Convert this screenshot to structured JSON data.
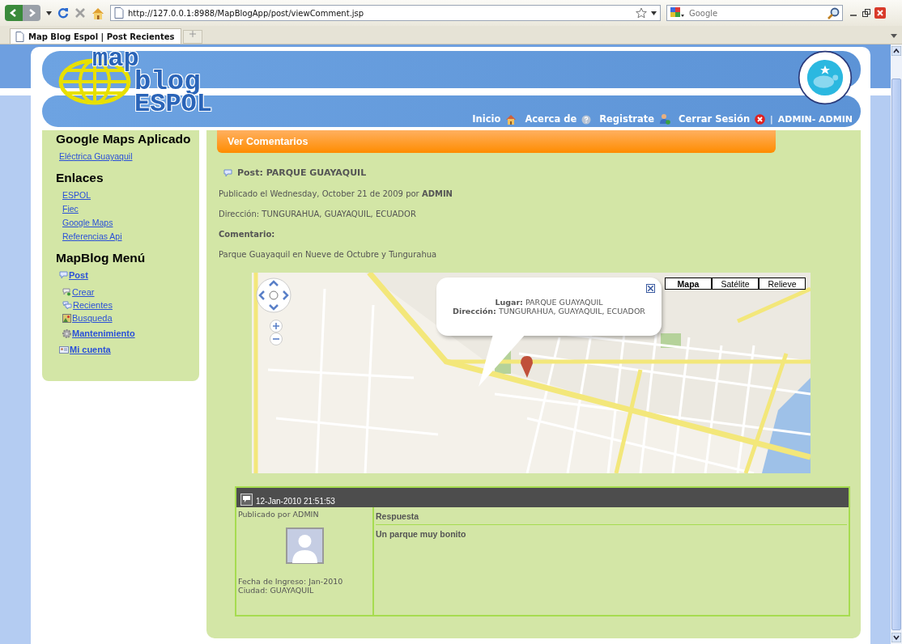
{
  "browser": {
    "url": "http://127.0.0.1:8988/MapBlogApp/post/viewComment.jsp",
    "search_placeholder": "Google",
    "tab_title": "Map Blog Espol | Post Recientes"
  },
  "header": {
    "logo_lines": [
      "map",
      "blog",
      "ESPOL"
    ],
    "nav": [
      {
        "label": "Inicio",
        "kind": "home"
      },
      {
        "label": "Acerca de",
        "kind": "help"
      },
      {
        "label": "Registrate",
        "kind": "user"
      },
      {
        "label": "Cerrar Sesión",
        "kind": "close"
      }
    ],
    "separator": "|",
    "user": "ADMIN- ADMIN"
  },
  "sidebar": {
    "sections": [
      {
        "title": "Google Maps Aplicado",
        "items": [
          {
            "label": "Eléctrica Guayaquil",
            "kind": "plain"
          }
        ]
      },
      {
        "title": "Enlaces",
        "items": [
          {
            "label": "ESPOL",
            "kind": "plain"
          },
          {
            "label": "Fiec",
            "kind": "plain"
          },
          {
            "label": "Google Maps",
            "kind": "plain"
          },
          {
            "label": "Referencias Api",
            "kind": "plain"
          }
        ]
      },
      {
        "title": "MapBlog Menú",
        "items": [
          {
            "label": "Post",
            "kind": "comment",
            "children": [
              {
                "label": "Crear",
                "kind": "create"
              },
              {
                "label": "Recientes",
                "kind": "comments"
              },
              {
                "label": "Busqueda",
                "kind": "search"
              },
              {
                "label": "Mantenimiento",
                "kind": "gear"
              }
            ]
          },
          {
            "label": "Mi cuenta",
            "kind": "card"
          }
        ]
      }
    ]
  },
  "main": {
    "section_title": "Ver Comentarios",
    "post_label": "Post:",
    "post_title": "PARQUE GUAYAQUIL",
    "published": "Publicado el Wednesday, October 21 de 2009 por **ADMIN**",
    "address": "Dirección: TUNGURAHUA, GUAYAQUIL, ECUADOR",
    "comment_label": "Comentario:",
    "comment_text": "Parque Guayaquil en Nueve de Octubre y Tungurahua",
    "map": {
      "kind": "picture",
      "map_types": [
        {
          "label": "Mapa",
          "selected": true
        },
        {
          "label": "Satélite",
          "selected": false
        },
        {
          "label": "Relieve",
          "selected": false
        }
      ],
      "info_lines": [
        "**Lugar:** PARQUE GUAYAQUIL",
        "**Dirección:** TUNGURAHUA, GUAYAQUIL, ECUADOR"
      ]
    },
    "comments": [
      {
        "timestamp": "12-Jan-2010 21:51:53",
        "author": "Publicado por ADMIN",
        "joined": "Fecha de Ingreso: Jan-2010",
        "city": "Ciudad: GUAYAQUIL",
        "heading": "Respuesta",
        "text": "Un parque muy bonito"
      }
    ]
  }
}
